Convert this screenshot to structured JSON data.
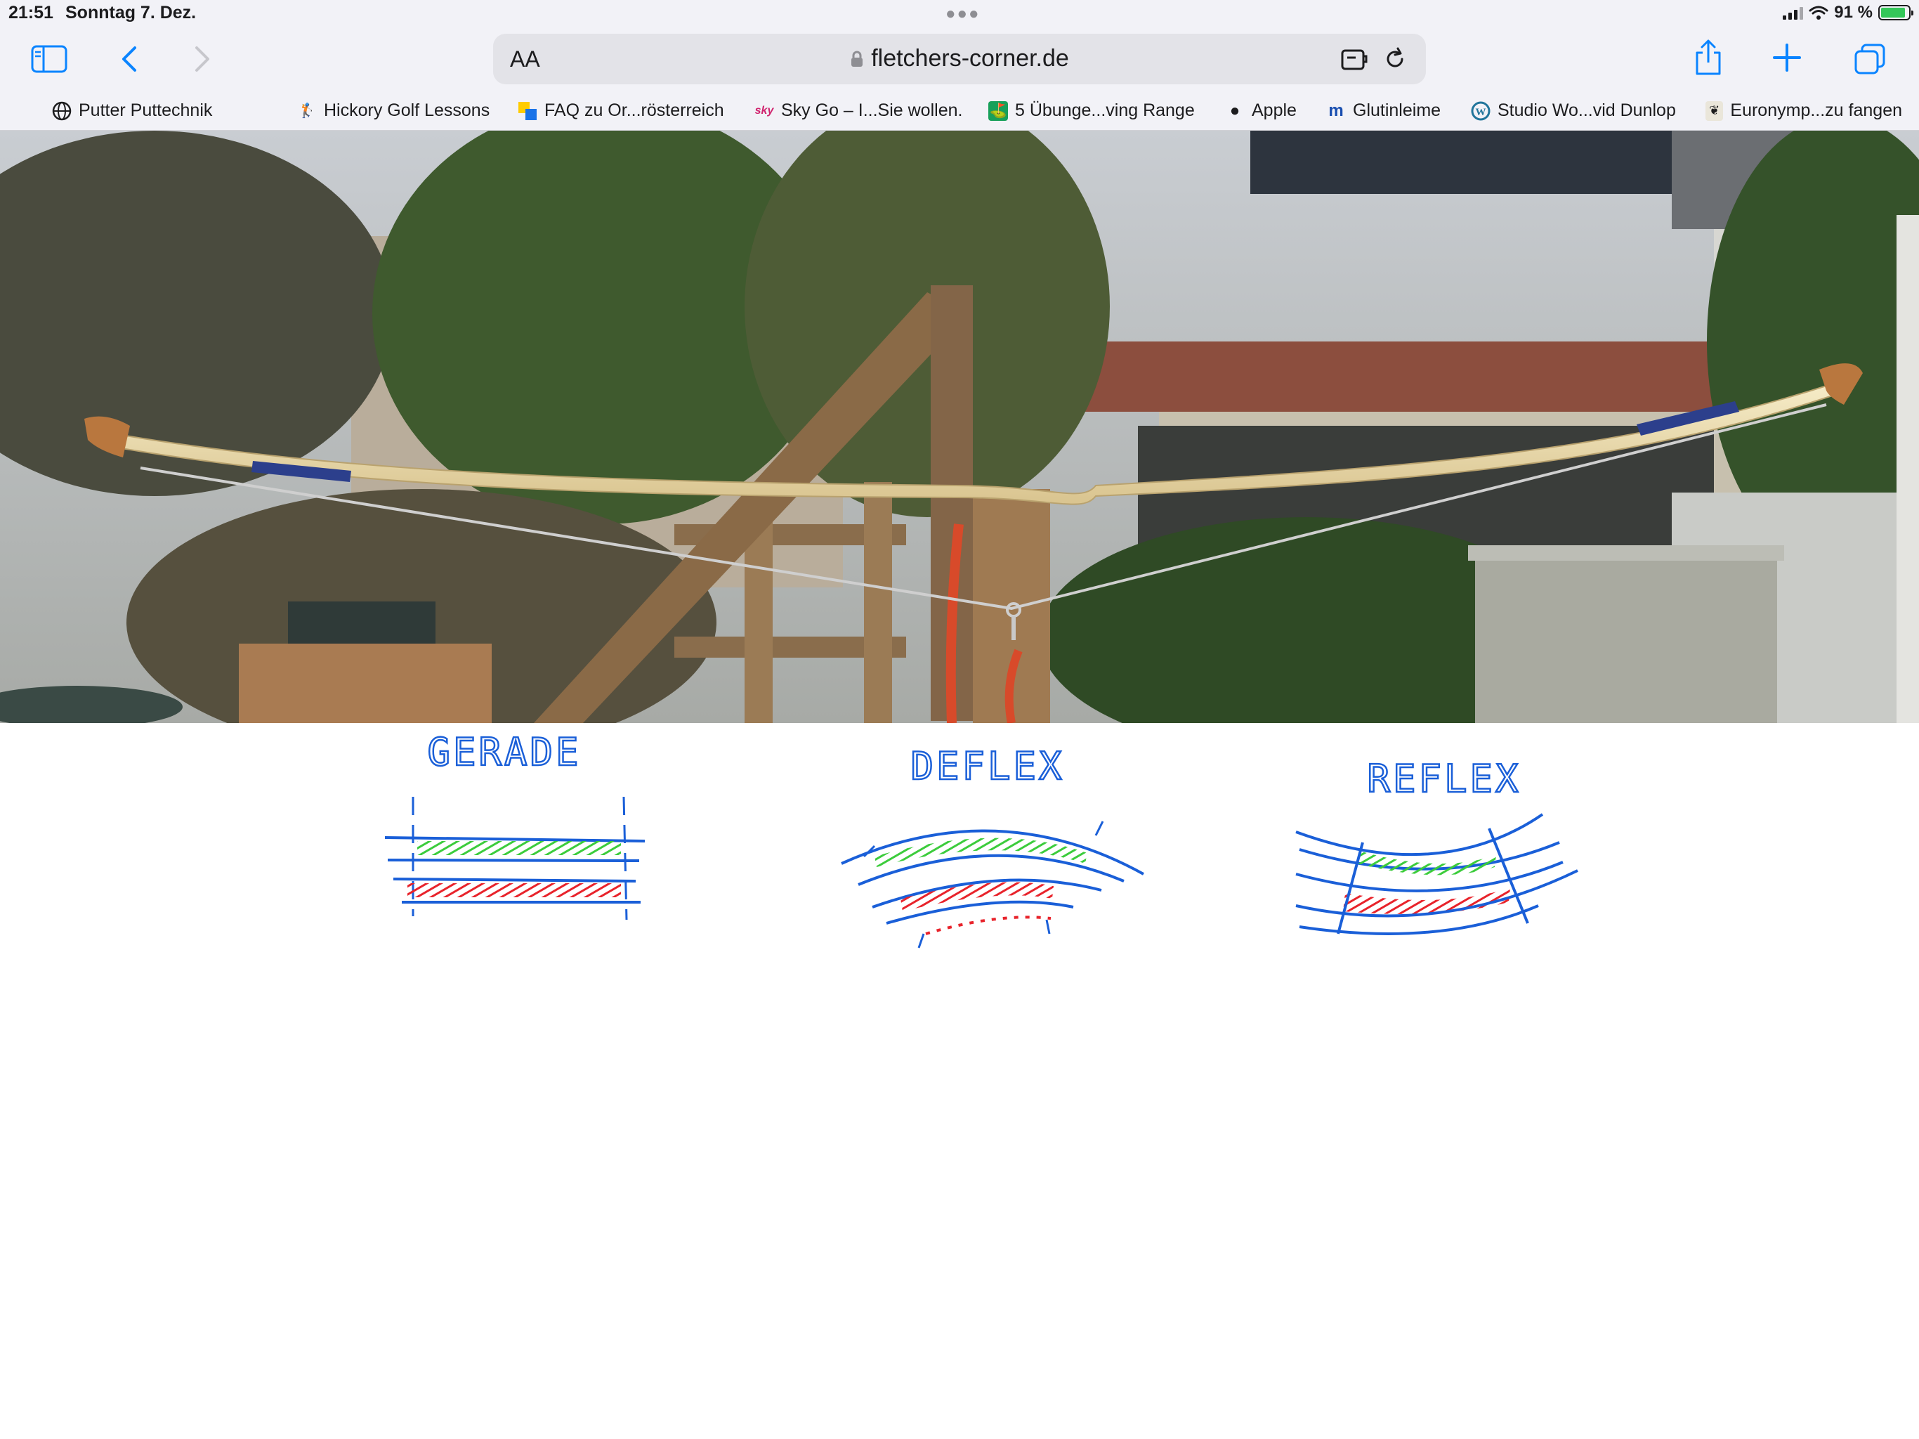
{
  "status_bar": {
    "time": "21:51",
    "date": "Sonntag 7. Dez.",
    "battery": "91 %"
  },
  "toolbar": {
    "text_size_label": "AA",
    "url": "fletchers-corner.de"
  },
  "bookmarks": [
    {
      "label": "Putter Puttechnik",
      "icon": "globe-icon"
    },
    {
      "label": "Hickory Golf Lessons",
      "icon": "golfer-icon"
    },
    {
      "label": "FAQ zu Or...rösterreich",
      "icon": "squares-icon"
    },
    {
      "label": "Sky Go – I...Sie wollen.",
      "icon": "sky-icon"
    },
    {
      "label": "5 Übunge...ving Range",
      "icon": "golf-green-icon"
    },
    {
      "label": "Apple",
      "icon": "apple-icon"
    },
    {
      "label": "Glutinleime",
      "icon": "m-icon"
    },
    {
      "label": "Studio Wo...vid Dunlop",
      "icon": "wordpress-icon"
    },
    {
      "label": "Euronymp...zu fangen",
      "icon": "fly-icon"
    }
  ],
  "diagrams": {
    "gerade": "GERADE",
    "deflex": "DEFLEX",
    "reflex": "REFLEX"
  },
  "colors": {
    "sketch_blue": "#1a5fd8",
    "sketch_green": "#3ccc3c",
    "sketch_red": "#e8232b",
    "accent": "#0a84ff"
  }
}
